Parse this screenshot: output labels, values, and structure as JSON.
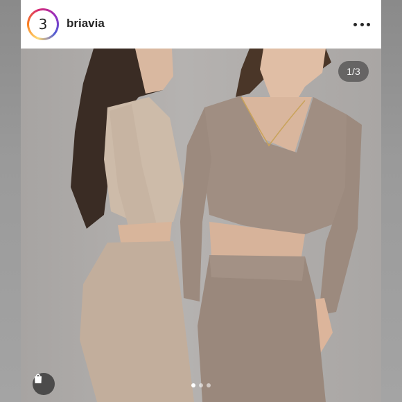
{
  "post": {
    "avatar_glyph": "3",
    "username": "briavia",
    "more_icon": "more-horizontal-icon",
    "image_counter": "1/3",
    "carousel": {
      "total": 3,
      "active_index": 0
    },
    "shop_icon": "shopping-bag-icon"
  },
  "colors": {
    "header_bg": "#ffffff",
    "username_text": "#262626",
    "photo_background": "#b0adab",
    "outfit_left": "#cbb9a8",
    "outfit_right": "#9e8c80"
  }
}
